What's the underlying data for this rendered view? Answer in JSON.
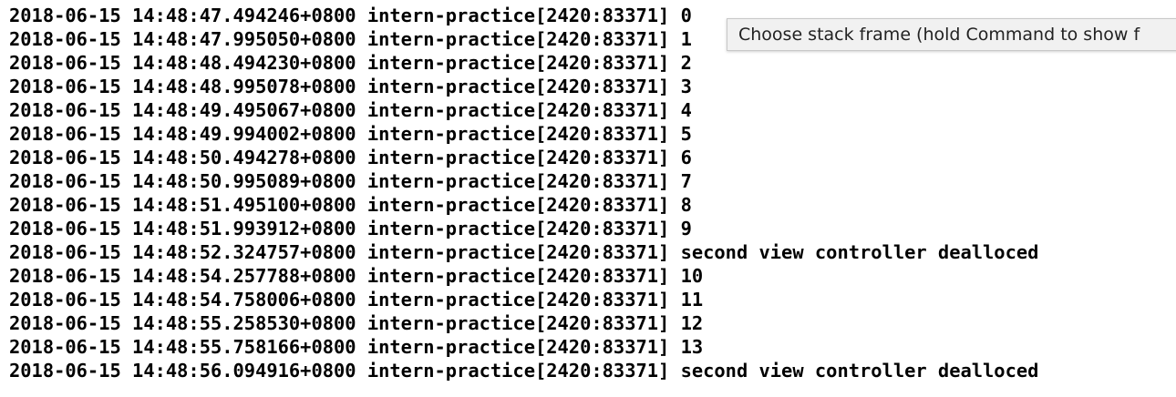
{
  "console": {
    "lines": [
      "2018-06-15 14:48:47.494246+0800 intern-practice[2420:83371] 0",
      "2018-06-15 14:48:47.995050+0800 intern-practice[2420:83371] 1",
      "2018-06-15 14:48:48.494230+0800 intern-practice[2420:83371] 2",
      "2018-06-15 14:48:48.995078+0800 intern-practice[2420:83371] 3",
      "2018-06-15 14:48:49.495067+0800 intern-practice[2420:83371] 4",
      "2018-06-15 14:48:49.994002+0800 intern-practice[2420:83371] 5",
      "2018-06-15 14:48:50.494278+0800 intern-practice[2420:83371] 6",
      "2018-06-15 14:48:50.995089+0800 intern-practice[2420:83371] 7",
      "2018-06-15 14:48:51.495100+0800 intern-practice[2420:83371] 8",
      "2018-06-15 14:48:51.993912+0800 intern-practice[2420:83371] 9",
      "2018-06-15 14:48:52.324757+0800 intern-practice[2420:83371] second view controller dealloced",
      "2018-06-15 14:48:54.257788+0800 intern-practice[2420:83371] 10",
      "2018-06-15 14:48:54.758006+0800 intern-practice[2420:83371] 11",
      "2018-06-15 14:48:55.258530+0800 intern-practice[2420:83371] 12",
      "2018-06-15 14:48:55.758166+0800 intern-practice[2420:83371] 13",
      "2018-06-15 14:48:56.094916+0800 intern-practice[2420:83371] second view controller dealloced"
    ]
  },
  "tooltip": {
    "text": "Choose stack frame (hold Command to show f"
  }
}
